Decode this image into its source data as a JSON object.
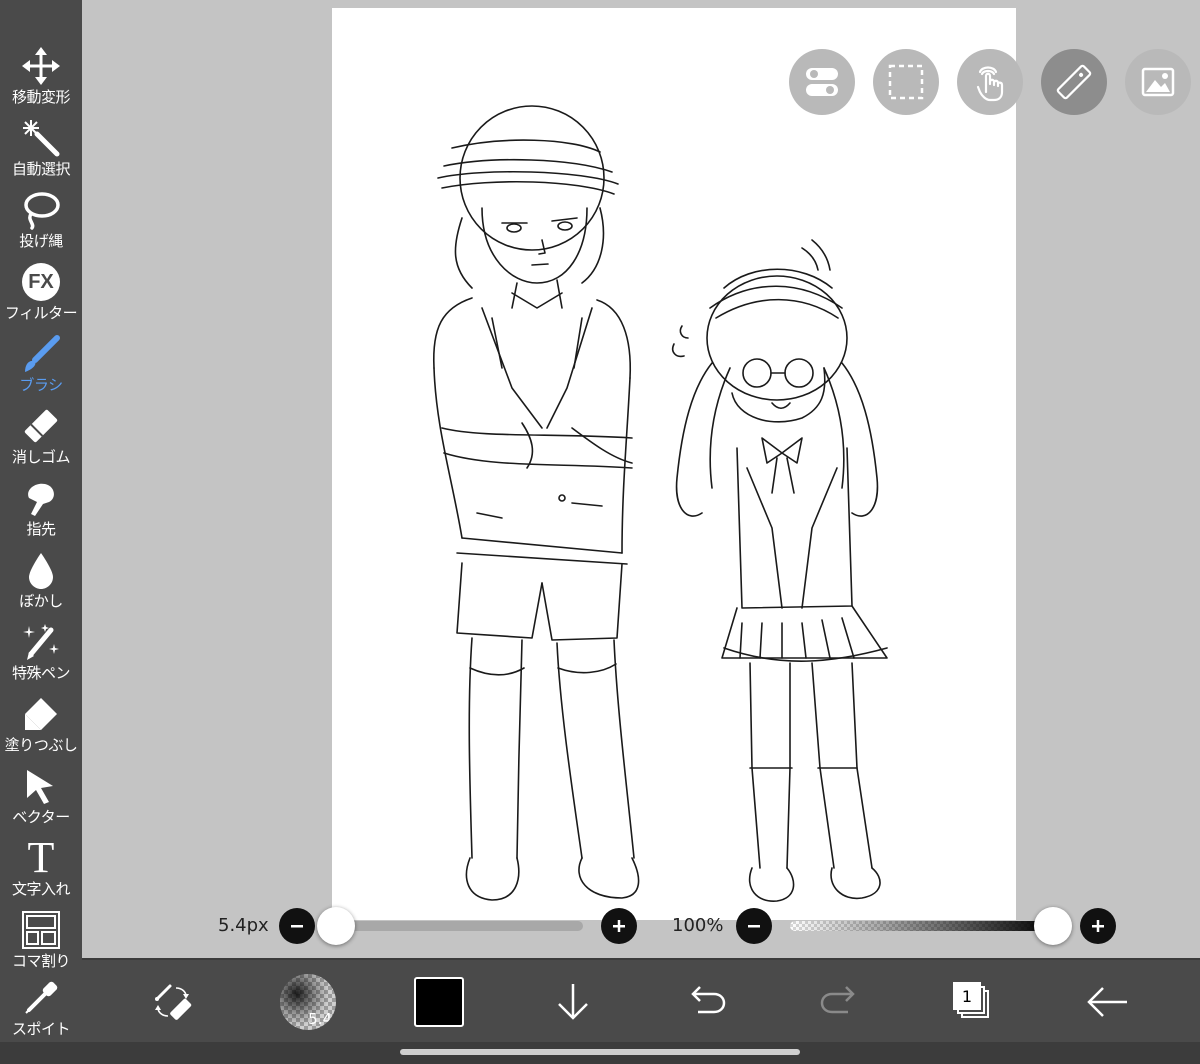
{
  "left_toolbar": {
    "tools": [
      {
        "label": "移動変形",
        "icon": "move-icon"
      },
      {
        "label": "自動選択",
        "icon": "magic-wand-icon"
      },
      {
        "label": "投げ縄",
        "icon": "lasso-icon"
      },
      {
        "label": "フィルター",
        "icon": "fx-icon"
      },
      {
        "label": "ブラシ",
        "icon": "brush-icon",
        "active": true
      },
      {
        "label": "消しゴム",
        "icon": "eraser-icon"
      },
      {
        "label": "指先",
        "icon": "finger-icon"
      },
      {
        "label": "ぼかし",
        "icon": "blur-drop-icon"
      },
      {
        "label": "特殊ペン",
        "icon": "special-pen-icon"
      },
      {
        "label": "塗りつぶし",
        "icon": "fill-icon"
      },
      {
        "label": "ベクター",
        "icon": "vector-arrow-icon"
      },
      {
        "label": "文字入れ",
        "icon": "text-icon"
      },
      {
        "label": "コマ割り",
        "icon": "panel-icon"
      },
      {
        "label": "スポイト",
        "icon": "eyedropper-icon"
      }
    ],
    "fx_glyph": "FX",
    "text_glyph": "T",
    "active_color": "#5a9cf0"
  },
  "floating_buttons": [
    {
      "icon": "toggle-icon"
    },
    {
      "icon": "selection-rect-icon"
    },
    {
      "icon": "touch-hand-icon"
    },
    {
      "icon": "ruler-icon"
    },
    {
      "icon": "image-icon"
    }
  ],
  "brush_size": {
    "value_label": "5.4px",
    "fraction": 0.0
  },
  "opacity": {
    "value_label": "100%",
    "fraction": 1.0
  },
  "bottom_toolbar": {
    "items": [
      {
        "icon": "swap-brush-eraser-icon"
      },
      {
        "icon": "brush-preview-icon",
        "label": "5.4"
      },
      {
        "icon": "color-swatch-icon",
        "color": "#000000"
      },
      {
        "icon": "download-arrow-icon"
      },
      {
        "icon": "undo-icon"
      },
      {
        "icon": "redo-icon",
        "disabled": true
      },
      {
        "icon": "layers-icon",
        "label": "1"
      },
      {
        "icon": "back-arrow-icon"
      }
    ]
  },
  "colors": {
    "toolbar": "#4a4a4a",
    "background": "#c4c4c4",
    "canvas": "#ffffff"
  }
}
